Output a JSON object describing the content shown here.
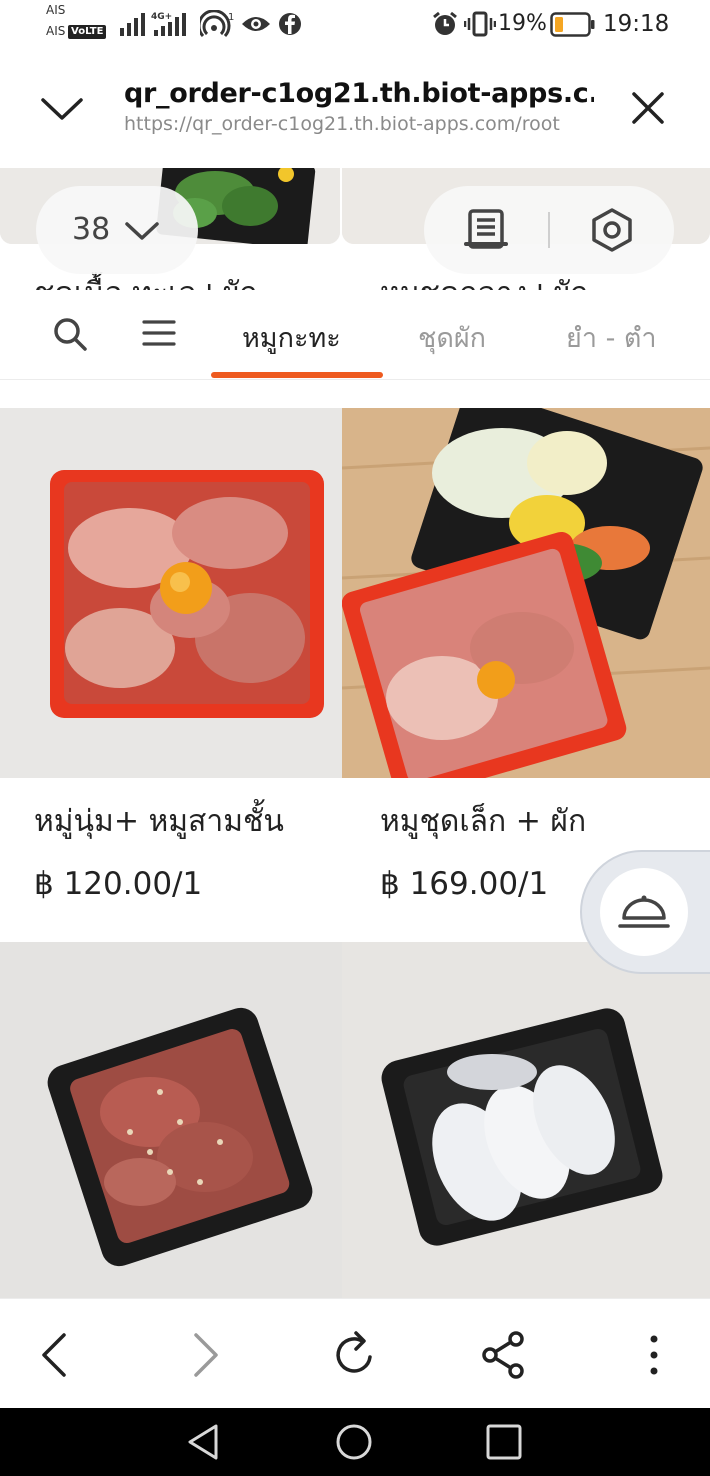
{
  "status_bar": {
    "carrier_top": "AIS",
    "carrier_bottom": "AIS",
    "volte": "VoLTE",
    "network": "4G+",
    "hotspot_count": "1",
    "battery": "19%",
    "time": "19:18"
  },
  "browser": {
    "title": "qr_order-c1og21.th.biot-apps.c...",
    "url": "https://qr_order-c1og21.th.biot-apps.com/root"
  },
  "page": {
    "table_number": "38",
    "peek_left_label": "ชุดเนื้อ ทะเล+ผัก",
    "peek_right_label": "หมูชุดกลาง+ผัก",
    "tabs": [
      {
        "label": "หมูกะทะ",
        "active": true
      },
      {
        "label": "ชุดผัก",
        "active": false
      },
      {
        "label": "ยำ - ตำ",
        "active": false
      }
    ],
    "products": [
      {
        "name": "หมู่นุ่ม+ หมูสามชั้น",
        "price": "฿ 120.00/1"
      },
      {
        "name": "หมูชุดเล็ก + ผัก",
        "price": "฿ 169.00/1"
      },
      {
        "name": "",
        "price": ""
      },
      {
        "name": "",
        "price": ""
      }
    ]
  },
  "colors": {
    "accent": "#ee5a1f",
    "tray_red": "#e8371f",
    "tray_black": "#1b1b1b"
  }
}
